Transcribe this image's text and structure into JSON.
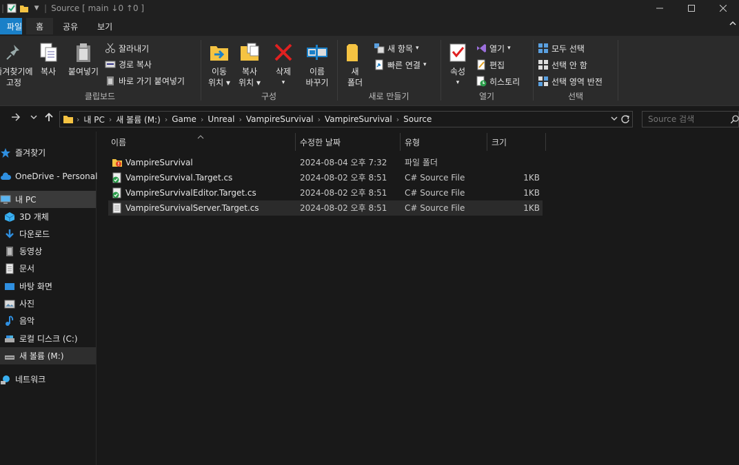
{
  "titlebar": {
    "text": "Source [ main ↓0 ↑0 ]",
    "separator": "|"
  },
  "ribbon_tabs": [
    {
      "label": "파일"
    },
    {
      "label": "홈"
    },
    {
      "label": "공유"
    },
    {
      "label": "보기"
    }
  ],
  "ribbon": {
    "clipboard": {
      "pin_label_1": "즐겨찾기에",
      "pin_label_2": "고정",
      "copy": "복사",
      "paste": "붙여넣기",
      "cut": "잘라내기",
      "copy_path": "경로 복사",
      "paste_shortcut": "바로 가기 붙여넣기",
      "group": "클립보드"
    },
    "organize": {
      "move_1": "이동",
      "move_2": "위치",
      "copyto_1": "복사",
      "copyto_2": "위치",
      "delete": "삭제",
      "rename_1": "이름",
      "rename_2": "바꾸기",
      "group": "구성"
    },
    "new": {
      "folder_1": "새",
      "folder_2": "폴더",
      "new_item": "새 항목",
      "easy_access": "빠른 연결",
      "group": "새로 만들기"
    },
    "open": {
      "properties": "속성",
      "open": "열기",
      "edit": "편집",
      "history": "히스토리",
      "group": "열기"
    },
    "select": {
      "select_all": "모두 선택",
      "select_none": "선택 안 함",
      "invert": "선택 영역 반전",
      "group": "선택"
    }
  },
  "address": {
    "crumbs": [
      "내 PC",
      "새 볼륨 (M:)",
      "Game",
      "Unreal",
      "VampireSurvival",
      "VampireSurvival",
      "Source"
    ],
    "search_placeholder": "Source 검색"
  },
  "sidebar": {
    "items": [
      {
        "label": "즐겨찾기"
      },
      {
        "label": "OneDrive - Personal"
      },
      {
        "label": "내 PC"
      },
      {
        "label": "3D 개체"
      },
      {
        "label": "다운로드"
      },
      {
        "label": "동영상"
      },
      {
        "label": "문서"
      },
      {
        "label": "바탕 화면"
      },
      {
        "label": "사진"
      },
      {
        "label": "음악"
      },
      {
        "label": "로컬 디스크 (C:)"
      },
      {
        "label": "새 볼륨 (M:)"
      },
      {
        "label": "네트워크"
      }
    ]
  },
  "columns": {
    "name": "이름",
    "modified": "수정한 날짜",
    "type": "유형",
    "size": "크기"
  },
  "files": [
    {
      "name": "VampireSurvival",
      "modified": "2024-08-04 오후 7:32",
      "type": "파일 폴더",
      "size": ""
    },
    {
      "name": "VampireSurvival.Target.cs",
      "modified": "2024-08-02 오후 8:51",
      "type": "C# Source File",
      "size": "1KB"
    },
    {
      "name": "VampireSurvivalEditor.Target.cs",
      "modified": "2024-08-02 오후 8:51",
      "type": "C# Source File",
      "size": "1KB"
    },
    {
      "name": "VampireSurvivalServer.Target.cs",
      "modified": "2024-08-02 오후 8:51",
      "type": "C# Source File",
      "size": "1KB"
    }
  ],
  "colors": {
    "accent": "#1a80c8",
    "folder": "#f5c342",
    "background": "#191919"
  }
}
